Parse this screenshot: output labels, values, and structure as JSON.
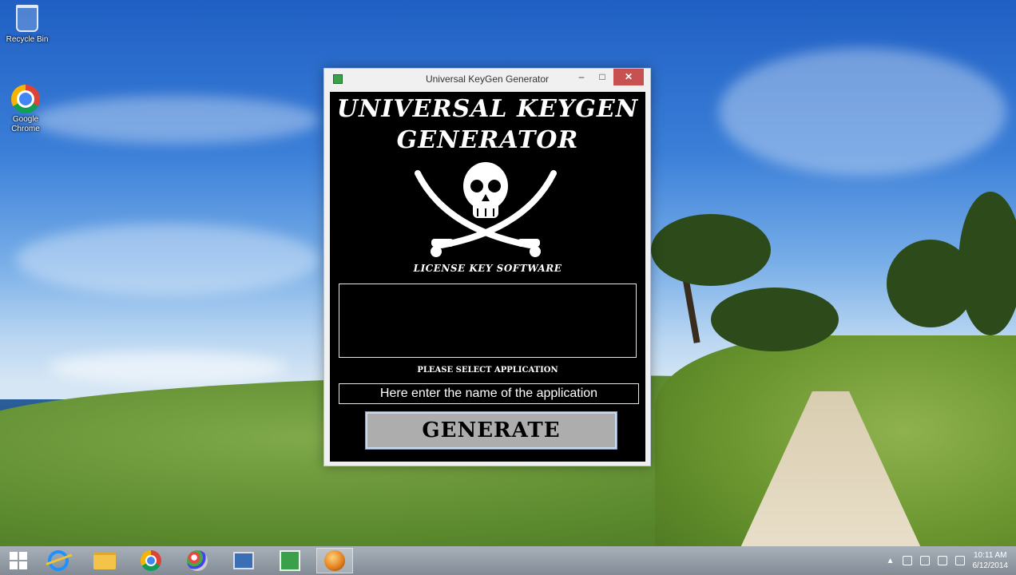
{
  "desktop": {
    "icons": [
      {
        "label": "Recycle Bin",
        "icon": "recycle-bin-icon"
      },
      {
        "label": "Google Chrome",
        "icon": "chrome-icon"
      }
    ]
  },
  "window": {
    "title": "Universal KeyGen Generator",
    "minimize": "–",
    "maximize": "□",
    "close": "✕",
    "app_title_line1": "UNIVERSAL KEYGEN",
    "app_title_line2": "GENERATOR",
    "subtitle": "LICENSE KEY SOFTWARE",
    "key_output": "",
    "select_label": "PLEASE SELECT APPLICATION",
    "app_input_value": "Here enter the name of the application",
    "generate_label": "GENERATE"
  },
  "taskbar": {
    "items": [
      "start-icon",
      "internet-explorer-icon",
      "file-explorer-icon",
      "chrome-icon",
      "paint-icon",
      "network-icon",
      "green-app-icon",
      "keygen-app-icon"
    ],
    "clock_time": "10:11 AM",
    "clock_date": "6/12/2014"
  },
  "colors": {
    "window_bg": "#000000",
    "button_bg": "#adadad",
    "close_btn": "#c75050"
  }
}
